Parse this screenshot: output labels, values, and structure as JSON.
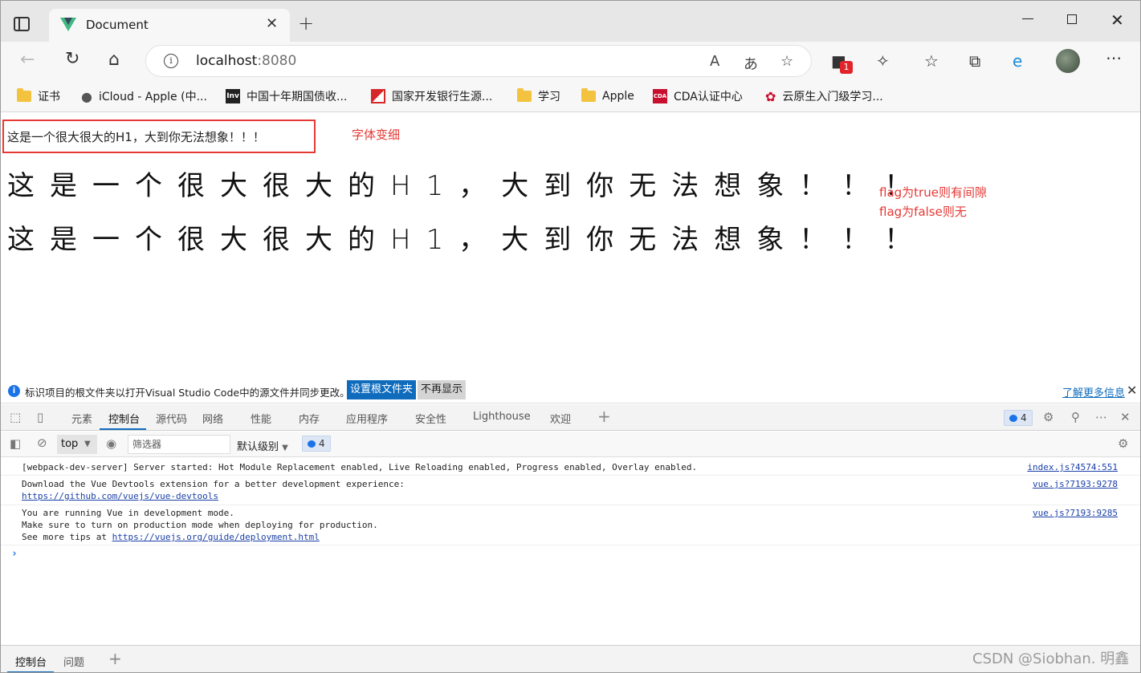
{
  "browser": {
    "tab_title": "Document",
    "new_tab": "+",
    "close_tab": "✕",
    "window_controls": {
      "close": "✕"
    },
    "url_host": "localhost",
    "url_port": ":8080",
    "notification_count": "1"
  },
  "bookmarks": [
    {
      "label": "证书",
      "icon": "folder-icon"
    },
    {
      "label": "iCloud - Apple (中...",
      "icon": "apple-icon"
    },
    {
      "label": "中国十年期国债收...",
      "icon": "investing-icon",
      "glyph": "Inv"
    },
    {
      "label": "国家开发银行生源...",
      "icon": "cdb-icon"
    },
    {
      "label": "学习",
      "icon": "folder-icon"
    },
    {
      "label": "Apple",
      "icon": "folder-icon"
    },
    {
      "label": "CDA认证中心",
      "icon": "cda-icon",
      "glyph": "CDA"
    },
    {
      "label": "云原生入门级学习...",
      "icon": "huawei-icon"
    }
  ],
  "page": {
    "h1_thin": "这是一个很大很大的H1，大到你无法想象！！！",
    "note_thin": "字体变细",
    "h1_spaced_1": "这是一个很大很大的H1，大到你无法想象！！！",
    "h1_spaced_2": "这是一个很大很大的H1，大到你无法想象！！！",
    "note_flag_true": "flag为true则有间隙",
    "note_flag_false": "flag为false则无",
    "note_color": "#e53935"
  },
  "infobar": {
    "message": "标识项目的根文件夹以打开Visual Studio Code中的源文件并同步更改。",
    "primary_button": "设置根文件夹",
    "secondary_button": "不再显示",
    "learn_more": "了解更多信息",
    "close": "✕"
  },
  "devtools": {
    "tabs": [
      "元素",
      "控制台",
      "源代码",
      "网络",
      "性能",
      "内存",
      "应用程序",
      "安全性",
      "Lighthouse",
      "欢迎"
    ],
    "active_tab": "控制台",
    "add_tab": "+",
    "message_count": "4",
    "context": "top",
    "filter_placeholder": "筛选器",
    "level": "默认级别",
    "bottom_tabs": [
      "控制台",
      "问题"
    ],
    "bottom_add": "+"
  },
  "console": {
    "rows": [
      {
        "lines": [
          "[webpack-dev-server] Server started: Hot Module Replacement enabled, Live Reloading enabled, Progress enabled, Overlay enabled."
        ],
        "source": "index.js?4574:551"
      },
      {
        "lines": [
          "Download the Vue Devtools extension for a better development experience:"
        ],
        "link": "https://github.com/vuejs/vue-devtools",
        "source": "vue.js?7193:9278"
      },
      {
        "lines": [
          "You are running Vue in development mode.",
          "Make sure to turn on production mode when deploying for production."
        ],
        "prefix": "See more tips at ",
        "link": "https://vuejs.org/guide/deployment.html",
        "source": "vue.js?7193:9285"
      }
    ],
    "prompt": "›"
  },
  "watermark": "CSDN @Siobhan. 明鑫"
}
